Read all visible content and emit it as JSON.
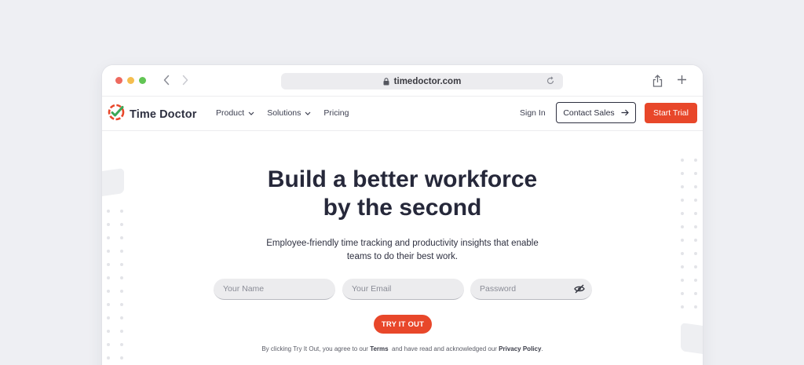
{
  "browser": {
    "url": "timedoctor.com",
    "icons": [
      "back-icon",
      "forward-icon",
      "lock-icon",
      "reload-icon",
      "share-icon",
      "new-tab-icon"
    ]
  },
  "header": {
    "brand": "Time Doctor",
    "nav": [
      {
        "label": "Product",
        "has_dropdown": true
      },
      {
        "label": "Solutions",
        "has_dropdown": true
      },
      {
        "label": "Pricing",
        "has_dropdown": false
      }
    ],
    "sign_in": "Sign In",
    "contact_sales": "Contact Sales",
    "start_trial": "Start Trial"
  },
  "hero": {
    "title_line1": "Build a better workforce",
    "title_line2": "by the second",
    "subtitle_line1": "Employee-friendly time tracking and productivity insights that enable",
    "subtitle_line2": "teams to do their best work.",
    "name_placeholder": "Your Name",
    "email_placeholder": "Your Email",
    "password_placeholder": "Password",
    "cta": "TRY IT OUT",
    "legal": {
      "prefix": "By clicking Try It Out, you agree to our ",
      "terms": "Terms",
      "middle": "  and have read and acknowledged our ",
      "privacy": "Privacy Policy",
      "suffix": "."
    }
  },
  "colors": {
    "accent": "#e8472a",
    "text_dark": "#26283a",
    "page_bg": "#eeeff3",
    "logo_green": "#3aa757"
  }
}
